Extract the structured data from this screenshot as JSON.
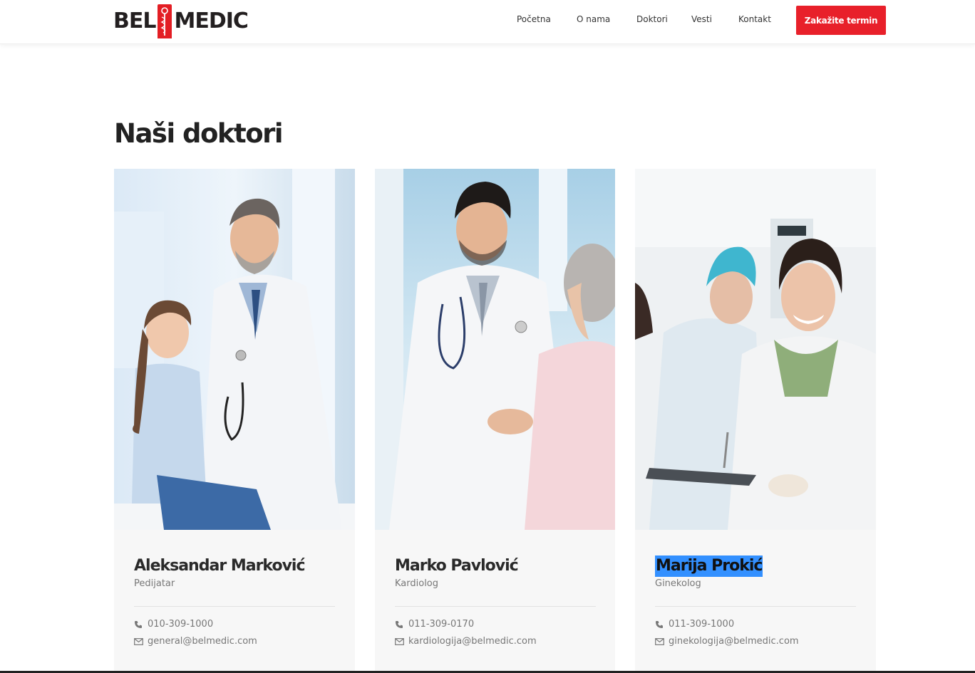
{
  "header": {
    "logo_left": "BEL",
    "logo_right": "MEDIC",
    "nav": [
      {
        "label": "Početna"
      },
      {
        "label": "O nama"
      },
      {
        "label": "Doktori"
      },
      {
        "label": "Vesti"
      },
      {
        "label": "Kontakt"
      }
    ],
    "cta_label": "Zakažite termin"
  },
  "colors": {
    "accent": "#e8202a",
    "selection": "#3390ff",
    "card_bg": "#f7f7f7"
  },
  "page_title": "Naši doktori",
  "doctors": [
    {
      "name": "Aleksandar Marković",
      "specialty": "Pedijatar",
      "phone": "010-309-1000",
      "email": "general@belmedic.com",
      "photo_icon": "doctor-with-child-photo"
    },
    {
      "name": "Marko Pavlović",
      "specialty": "Kardiolog",
      "phone": "011-309-0170",
      "email": "kardiologija@belmedic.com",
      "photo_icon": "doctor-with-patient-photo"
    },
    {
      "name": "Marija Prokić",
      "specialty": "Ginekolog",
      "phone": "011-309-1000",
      "email": "ginekologija@belmedic.com",
      "photo_icon": "female-doctor-photo"
    }
  ]
}
